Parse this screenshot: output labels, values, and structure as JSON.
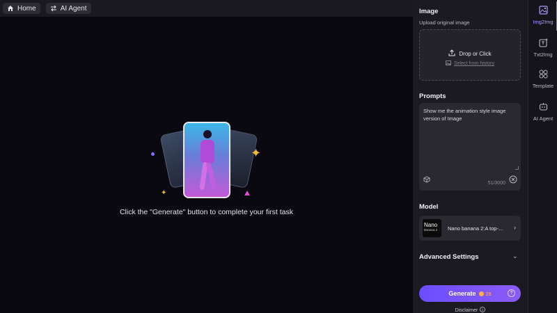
{
  "topbar": {
    "home_label": "Home",
    "agent_label": "AI Agent"
  },
  "main": {
    "empty_message": "Click the \"Generate\" button to complete your first task"
  },
  "panel": {
    "image": {
      "title": "Image",
      "subtitle": "Upload original image",
      "drop_label": "Drop or Click",
      "history_label": "Select from history"
    },
    "prompts": {
      "title": "Prompts",
      "text": "Show me the animation style image version of Image",
      "counter": "51/3000"
    },
    "model": {
      "title": "Model",
      "thumb_line1": "Nano",
      "thumb_line2": "Banana 2",
      "name": "Nano banana 2:A top-..."
    },
    "advanced": {
      "title": "Advanced Settings"
    },
    "generate": {
      "label": "Generate",
      "credits": "28"
    },
    "disclaimer": "Disclaimer"
  },
  "tabs": [
    {
      "label": "Img2Img",
      "icon": "image-edit-icon",
      "active": true
    },
    {
      "label": "Txt2Img",
      "icon": "text-image-icon",
      "active": false
    },
    {
      "label": "Template",
      "icon": "template-grid-icon",
      "active": false
    },
    {
      "label": "AI Agent",
      "icon": "robot-icon",
      "active": false
    }
  ],
  "colors": {
    "accent": "#8b5cf6",
    "background": "#0b0910",
    "panel": "#1b1a20"
  }
}
